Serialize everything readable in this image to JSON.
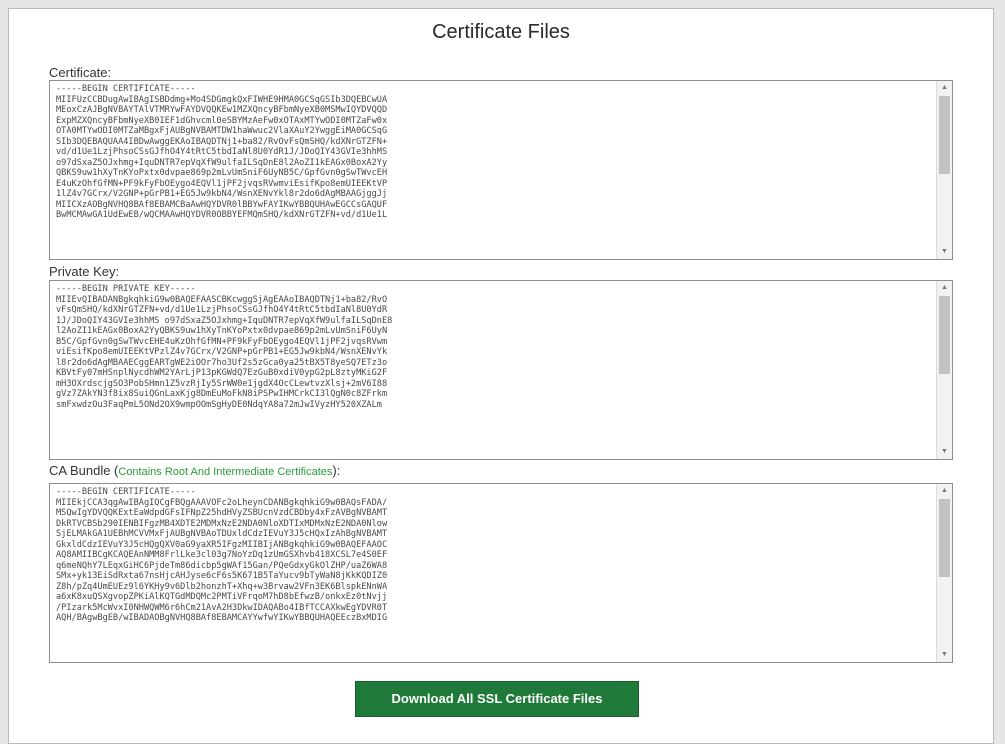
{
  "page": {
    "title": "Certificate Files"
  },
  "certificate": {
    "label": "Certificate:",
    "value": "-----BEGIN CERTIFICATE-----\nMIIFUzCCBDugAwIBAgISBDdmg+Mo4SDGmgkQxFIWHE9HMA0GCSqGSIb3DQEBCwUA\nMEoxCzAJBgNVBAYTAlVTMRYwFAYDVQQKEw1MZXQncyBFbmNyeXB0MSMwIQYDVQQD\nExpMZXQncyBFbmNyeXB0IEF1dGhvcml0eSBYMzAeFw0xOTAxMTYwODI0MTZaFw0x\nOTA0MTYwODI0MTZaMBgxFjAUBgNVBAMTDW1haWwuc2VlaXAuY2YwggEiMA0GCSqG\nSIb3DQEBAQUAA4IBDwAwggEKAoIBAQDTNj1+ba82/RvOvFsQmSHQ/kdXNrGTZFN+\nvd/d1Ue1LzjPhsoCSsGJfhO4Y4tRtC5tbdIaNl8U0YdR1J/JDoQIY43GVIe3hhMS\no97dSxaZ5OJxhmg+IquDNTR7epVqXfW9ulfaILSqDnE8l2AoZI1kEAGx0BoxA2Yy\nQBKS9uw1hXyTnKYoPxtx0dvpae869p2mLvUmSniF6UyNB5C/GpfGvn0gSwTWvcEH\nE4uKzOhfGfMN+PF9kFyFbOEygo4EQVl1jPF2jvqsRVwmviEsifKpo8emUIEEKtVP\n1lZ4v7GCrx/V2GNP+pGrPB1+EG5Jw9kbN4/WsnXENvYkl8r2do6dAgMBAAGjggJj\nMIICXzAOBgNVHQ8BAf8EBAMCBaAwHQYDVR0lBBYwFAYIKwYBBQUHAwEGCCsGAQUF\nBwMCMAwGA1UdEwEB/wQCMAAwHQYDVR0OBBYEFMQmSHQ/kdXNrGTZFN+vd/d1Ue1L"
  },
  "private_key": {
    "label": "Private Key:",
    "value": "-----BEGIN PRIVATE KEY-----\nMIIEvQIBADANBgkqhkiG9w0BAQEFAASCBKcwggSjAgEAAoIBAQDTNj1+ba82/RvO\nvFsQmSHQ/kdXNrGTZFN+vd/d1Ue1LzjPhsoCSsGJfhO4Y4tRtC5tbdIaNl8U0YdR\n1J/JDoQIY43GVIe3hhMS o97dSxaZ5OJxhmg+IquDNTR7epVqXfW9ulfaILSqDnE8\nl2AoZI1kEAGx0BoxA2YyQBKS9uw1hXyTnKYoPxtx0dvpae869p2mLvUmSniF6UyN\nB5C/GpfGvn0gSwTWvcEHE4uKzOhfGfMN+PF9kFyFbOEygo4EQVl1jPF2jvqsRVwm\nviEsifKpo8emUIEEKtVPzlZ4v7GCrx/V2GNP+pGrPB1+EG5Jw9kbN4/WsnXENvYk\nl8r2do6dAgMBAAECggEARTgWE2iOOr7ho3Uf2s5zGca0ya25tBX5T8yeSQ7ETz3o\nKBVtFy07mHSnplNycdhWM2YArLjP13pKGWdQ7EzGuB0xdiV0ypG2pL8ztyMKiG2F\nmH3OXrdscjgSO3PobSHmn1Z5vzRjIy5SrWW0e1jgdX4OcCLewtvzXlsj+2mV6I88\ngVz7ZAkYN3f8ix8SuiQGnLaxKjg8DmEuMoFkN8iPSPwIHMCrkCI3lQgN0c8ZFrkm\nsmFxwdzOu3FaqPmL5ONd2OX9wmpOOmSgHyDE0NdqYA8a72mJwIVyzHY520XZALm"
  },
  "ca_bundle": {
    "label": "CA Bundle (",
    "note": "Contains Root And Intermediate Certificates",
    "label_end": "):",
    "value": "-----BEGIN CERTIFICATE-----\nMIIEkjCCA3qgAwIBAgIQCgFBQgAAAVOFc2oLheynCDANBgkqhkiG9w0BAQsFADA/\nMSQwIgYDVQQKExtEaWdpdGFsIFNpZ25hdHVyZSBUcnVzdCBDby4xFzAVBgNVBAMT\nDkRTVCBSb290IENBIFgzMB4XDTE2MDMxNzE2NDA0NloXDTIxMDMxNzE2NDA0Nlow\nSjELMAkGA1UEBhMCVVMxFjAUBgNVBAoTDUxldCdzIEVuY3J5cHQxIzAhBgNVBAMT\nGkxldCdzIEVuY3J5cHQgQXV0aG9yaXR5IFgzMIIBIjANBgkqhkiG9w0BAQEFAAOC\nAQ8AMIIBCgKCAQEAnNMM8FrlLke3cl03g7NoYzDq1zUmGSXhvb418XCSL7e4S0EF\nq6meNQhY7LEqxGiHC6PjdeTm86dicbp5gWAf15Gan/PQeGdxyGkOlZHP/uaZ6WA8\nSMx+yk13EiSdRxta67nsHjcAHJyse6cF6s5K671B5TaYucv9bTyWaN8jKkKQDIZ0\nZ8h/pZq4UmEUEz9l6YKHy9v6Dlb2honzhT+Xhq+w3Brvaw2VFn3EK6BlspkENnWA\na6xK8xuQSXgvopZPKiAlKQTGdMDQMc2PMTiVFrqoM7hD8bEfwzB/onkxEz0tNvjj\n/PIzark5McWvxI0NHWQWM6r6hCm21AvA2H3DkwIDAQABo4IBfTCCAXkwEgYDVR0T\nAQH/BAgwBgEB/wIBADAOBgNVHQ8BAf8EBAMCAYYwfwYIKwYBBQUHAQEEczBxMDIG"
  },
  "buttons": {
    "download_all": "Download All SSL Certificate Files"
  },
  "icons": {
    "scroll_up": "scroll-up-arrow-icon",
    "scroll_down": "scroll-down-arrow-icon"
  },
  "colors": {
    "button_bg": "#1f7a3a",
    "note_green": "#2e9a3c"
  }
}
